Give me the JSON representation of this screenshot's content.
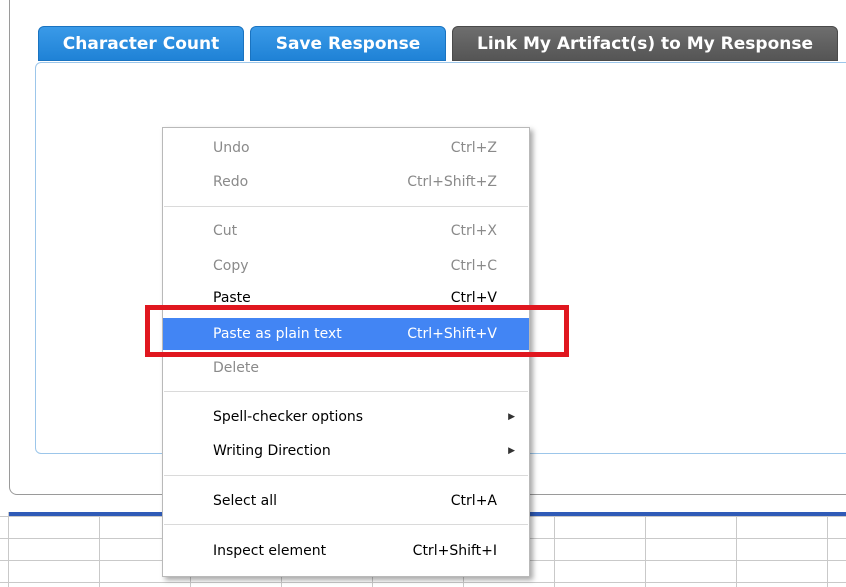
{
  "toolbar": {
    "character_count_label": "Character Count",
    "save_response_label": "Save Response",
    "link_artifacts_label": "Link My Artifact(s) to My Response"
  },
  "editor": {
    "content": ""
  },
  "context_menu": {
    "items": [
      {
        "label": "Undo",
        "shortcut": "Ctrl+Z",
        "state": "disabled"
      },
      {
        "label": "Redo",
        "shortcut": "Ctrl+Shift+Z",
        "state": "disabled"
      },
      {
        "label": "Cut",
        "shortcut": "Ctrl+X",
        "state": "disabled"
      },
      {
        "label": "Copy",
        "shortcut": "Ctrl+C",
        "state": "disabled"
      },
      {
        "label": "Paste",
        "shortcut": "Ctrl+V",
        "state": "enabled"
      },
      {
        "label": "Paste as plain text",
        "shortcut": "Ctrl+Shift+V",
        "state": "highlighted"
      },
      {
        "label": "Delete",
        "shortcut": "",
        "state": "disabled"
      },
      {
        "label": "Spell-checker options",
        "shortcut": "",
        "state": "enabled",
        "submenu": true
      },
      {
        "label": "Writing Direction",
        "shortcut": "",
        "state": "enabled",
        "submenu": true
      },
      {
        "label": "Select all",
        "shortcut": "Ctrl+A",
        "state": "enabled"
      },
      {
        "label": "Inspect element",
        "shortcut": "Ctrl+Shift+I",
        "state": "enabled"
      }
    ],
    "submenu_arrow": "▶"
  },
  "colors": {
    "button_blue": "#1f82d6",
    "button_gray": "#555555",
    "menu_highlight": "#4285f4",
    "annotation_red": "#e0171f",
    "disabled_text": "#8a8a8a"
  },
  "icons": {
    "submenu": "chevron-right-icon"
  }
}
